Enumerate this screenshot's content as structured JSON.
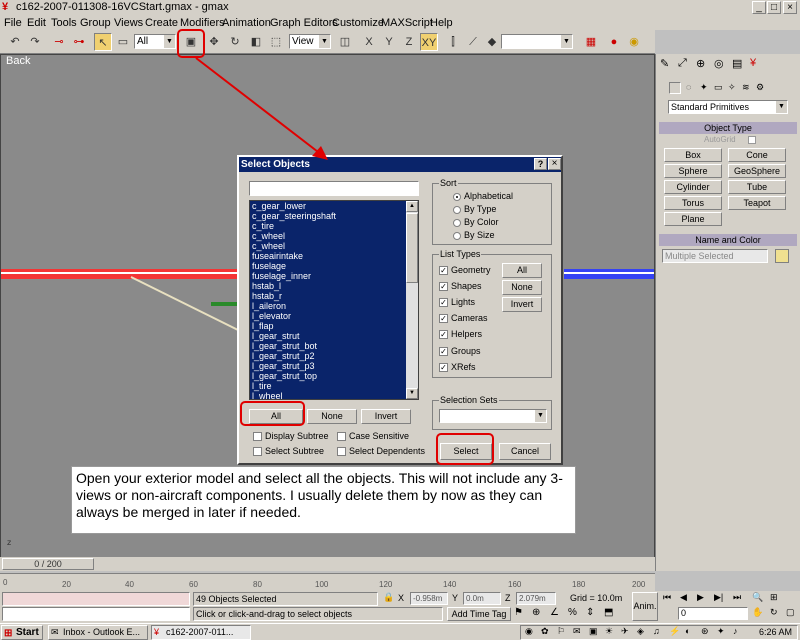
{
  "window": {
    "title": "c162-2007-011308-16VCStart.gmax - gmax"
  },
  "menu": [
    "File",
    "Edit",
    "Tools",
    "Group",
    "Views",
    "Create",
    "Modifiers",
    "Animation",
    "Graph Editors",
    "Customize",
    "MAXScript",
    "Help"
  ],
  "toolbar": {
    "selection_filter": "All",
    "ref_coord": "View",
    "named_sel": ""
  },
  "viewport": {
    "label": "Back"
  },
  "command_panel": {
    "dropdown": "Standard Primitives",
    "object_type_title": "Object Type",
    "autogrid": "AutoGrid",
    "primitives": [
      "Box",
      "Cone",
      "Sphere",
      "GeoSphere",
      "Cylinder",
      "Tube",
      "Torus",
      "Teapot",
      "Plane"
    ],
    "name_color_title": "Name and Color",
    "name_field": "Multiple Selected"
  },
  "dialog": {
    "title": "Select Objects",
    "help_btn": "?",
    "close_btn": "×",
    "objects": [
      "c_gear_lower",
      "c_gear_steeringshaft",
      "c_tire",
      "c_wheel",
      "c_wheel",
      "fuseairintake",
      "fuselage",
      "fuselage_inner",
      "hstab_l",
      "hstab_r",
      "l_aileron",
      "l_elevator",
      "l_flap",
      "l_gear_strut",
      "l_gear_strut_bot",
      "l_gear_strut_p2",
      "l_gear_strut_p3",
      "l_gear_strut_top",
      "l_tire",
      "l_wheel"
    ],
    "sort_label": "Sort",
    "sort_options": [
      "Alphabetical",
      "By Type",
      "By Color",
      "By Size"
    ],
    "list_types_label": "List Types",
    "list_types": [
      "Geometry",
      "Shapes",
      "Lights",
      "Cameras",
      "Helpers",
      "Groups",
      "XRefs"
    ],
    "lt_all": "All",
    "lt_none": "None",
    "lt_invert": "Invert",
    "sel_sets_label": "Selection Sets",
    "btn_all": "All",
    "btn_none": "None",
    "btn_invert": "Invert",
    "display_subtree": "Display Subtree",
    "case_sensitive": "Case Sensitive",
    "select_subtree": "Select Subtree",
    "select_dependents": "Select Dependents",
    "select_btn": "Select",
    "cancel_btn": "Cancel"
  },
  "caption": "Open your exterior model and select all the objects.  This will not include any 3-views or non-aircraft components.  I usually delete them by now as they can always be merged in later if needed.",
  "timeline": {
    "frame": "0 / 200",
    "ticks": [
      "0",
      "20",
      "40",
      "60",
      "80",
      "100",
      "120",
      "140",
      "160",
      "180",
      "200"
    ]
  },
  "status": {
    "selected": "49 Objects Selected",
    "prompt": "Click or click-and-drag to select objects",
    "x_label": "X",
    "x_val": "-0.958m",
    "y_label": "Y",
    "y_val": "0.0m",
    "z_label": "Z",
    "z_val": "2.079m",
    "grid": "Grid = 10.0m",
    "add_time_tag": "Add Time Tag",
    "anim": "Anim.",
    "frame_field": "0"
  },
  "taskbar": {
    "start": "Start",
    "task1": "Inbox - Outlook E...",
    "task2": "c162-2007-011...",
    "clock": "6:26 AM"
  }
}
